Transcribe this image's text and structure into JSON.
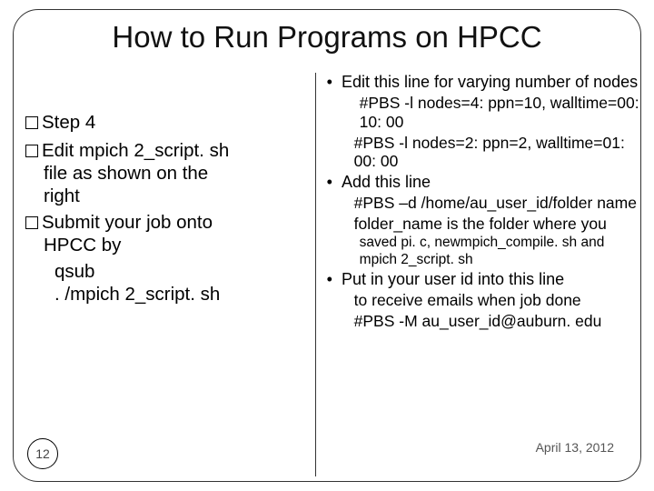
{
  "title": "How to Run Programs on HPCC",
  "left": {
    "step_label": "Step 4",
    "item1_a": "Edit mpich 2_script. sh",
    "item1_b": "file as shown on the",
    "item1_c": "right",
    "item2_a": "Submit your job onto",
    "item2_b": "HPCC by",
    "cmd1": "qsub",
    "cmd2": ". /mpich 2_script. sh"
  },
  "right": {
    "b1": "Edit this line for varying number of nodes",
    "b1_s1": "#PBS -l nodes=4: ppn=10, walltime=00: 10: 00",
    "b1_s2": "#PBS -l nodes=2: ppn=2, walltime=01: 00: 00",
    "b2": "Add this line",
    "b2_s1": "#PBS –d /home/au_user_id/folder name",
    "b2_s2a": "folder_name is the folder where you",
    "b2_s2b": "saved pi. c, newmpich_compile. sh and mpich 2_script. sh",
    "b3": "Put in your user id into this line",
    "b3_s1": "to receive emails when job done",
    "b3_s2": "#PBS -M au_user_id@auburn. edu"
  },
  "slide_number": "12",
  "slide_date": "April 13, 2012"
}
